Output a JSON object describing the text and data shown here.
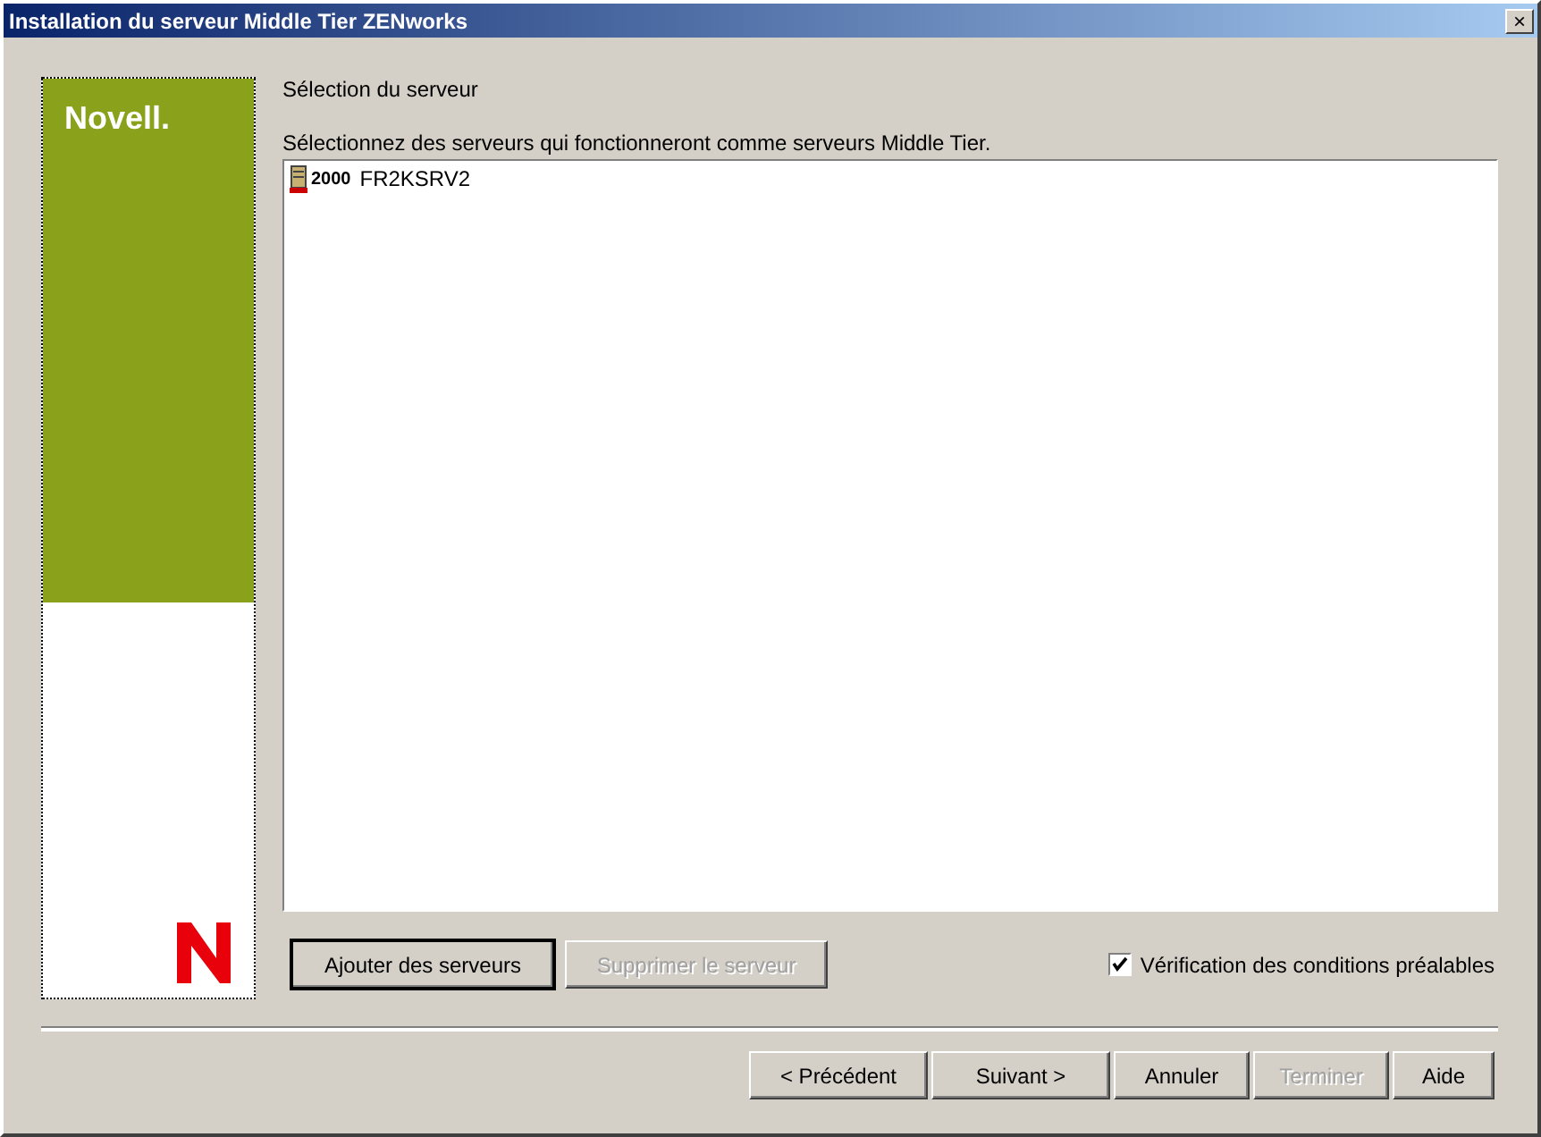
{
  "window": {
    "title": "Installation du serveur Middle Tier ZENworks",
    "close": "×"
  },
  "sidebar": {
    "logo_text": "Novell."
  },
  "heading": "Sélection du serveur",
  "instruction": "Sélectionnez des serveurs qui fonctionneront comme serveurs Middle Tier.",
  "servers": [
    {
      "badge": "2000",
      "name": "FR2KSRV2",
      "selected": false
    }
  ],
  "list_buttons": [
    {
      "label": "Ajouter des serveurs",
      "disabled": false,
      "focused": true
    },
    {
      "label": "Supprimer le serveur",
      "disabled": true,
      "focused": false
    }
  ],
  "prerequisite_check": {
    "label": "Vérification des conditions préalables",
    "checked": true
  },
  "footer_buttons": [
    {
      "label": "< Précédent",
      "disabled": false
    },
    {
      "label": "Suivant >",
      "disabled": false
    },
    {
      "label": "Annuler",
      "disabled": false
    },
    {
      "label": "Terminer",
      "disabled": true
    },
    {
      "label": "Aide",
      "disabled": false
    }
  ]
}
